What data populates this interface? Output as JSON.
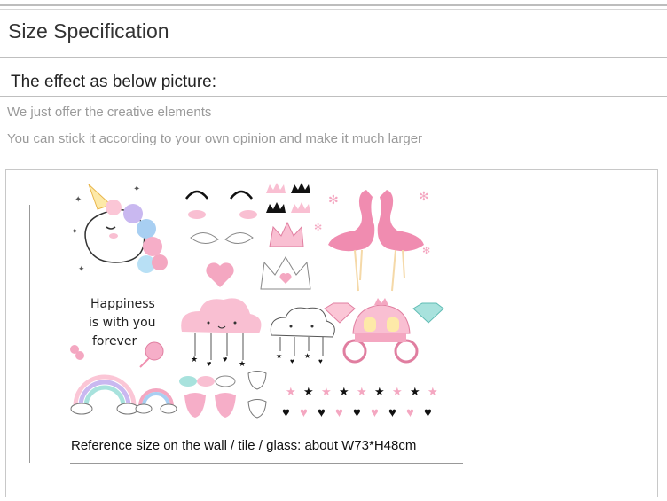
{
  "header": {
    "title": "Size Specification"
  },
  "effect": {
    "subtitle": "The effect as below picture:",
    "line1": "We just offer the creative elements",
    "line2": "You can stick it according to your own opinion and make it much larger"
  },
  "artwork": {
    "text_line1": "Happiness",
    "text_line2": "is with you",
    "text_line3": "forever",
    "caption": "Reference size on the wall / tile / glass: about W73*H48cm"
  },
  "colors": {
    "pink": "#f4a7c1",
    "light_pink": "#fcd3e0",
    "black": "#111111",
    "teal": "#9fe3dd",
    "flamingo": "#f08cb0"
  }
}
